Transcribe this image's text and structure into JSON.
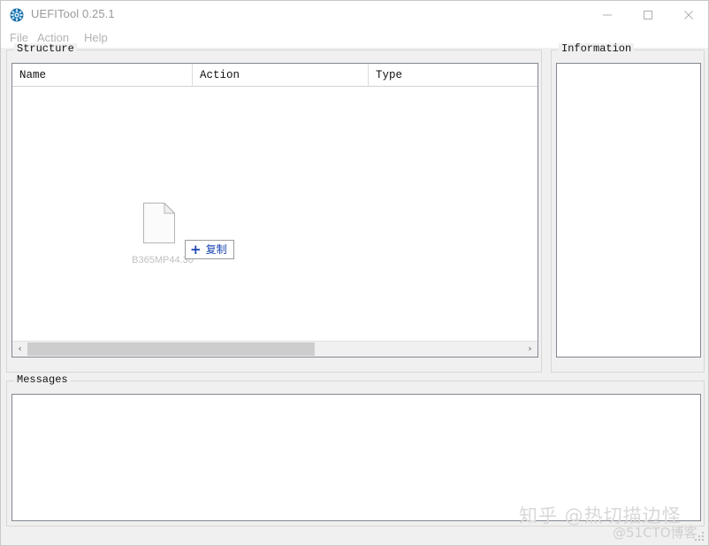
{
  "window": {
    "title": "UEFITool 0.25.1",
    "icon": "gear-icon",
    "accent_color": "#1b6fa8",
    "controls": {
      "minimize": "minimize-icon",
      "maximize": "maximize-icon",
      "close": "close-icon"
    }
  },
  "menubar": {
    "items": [
      {
        "label": "File"
      },
      {
        "label": "Action"
      },
      {
        "label": "Help"
      }
    ]
  },
  "structure": {
    "title": "Structure",
    "columns": [
      {
        "label": "Name"
      },
      {
        "label": "Action"
      },
      {
        "label": "Type"
      }
    ],
    "rows": [],
    "scrollbar": {
      "left_arrow": "‹",
      "right_arrow": "›",
      "thumb_percent": 58
    }
  },
  "information": {
    "title": "Information",
    "content": ""
  },
  "messages": {
    "title": "Messages",
    "content": ""
  },
  "drag_drop": {
    "filename": "B365MP44.30",
    "icon": "file-document-icon",
    "badge": {
      "plus": "+",
      "label": "复制",
      "text_color": "#1b44b0"
    }
  },
  "watermarks": {
    "primary": "知乎 @热切描边怪",
    "secondary": "@51CTO博客"
  }
}
